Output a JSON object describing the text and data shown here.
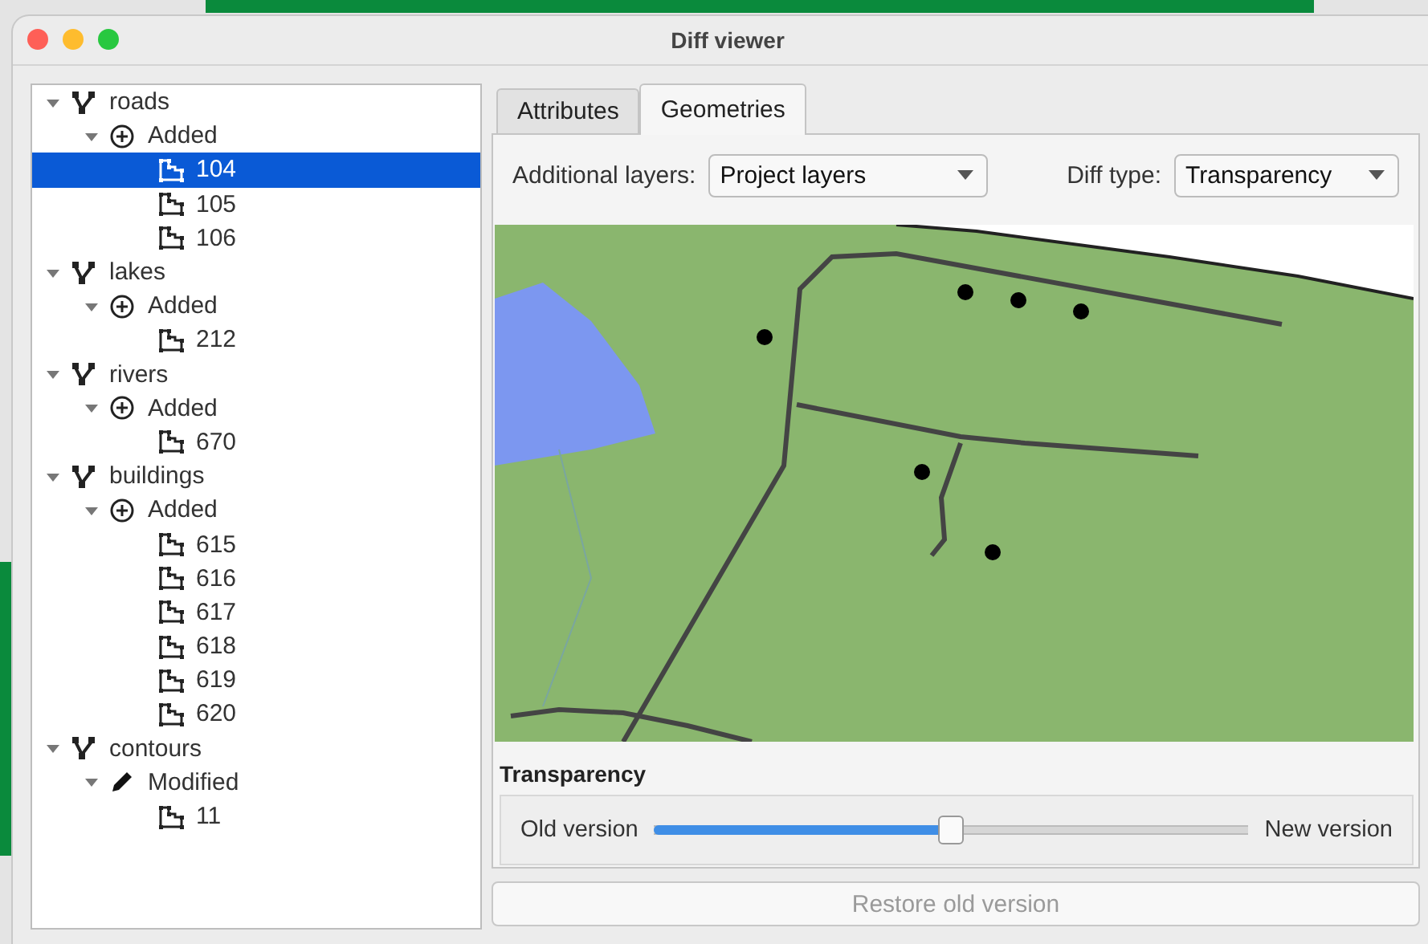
{
  "window": {
    "title": "Diff viewer"
  },
  "tree": [
    {
      "label": "roads",
      "kind": "layer",
      "expanded": true,
      "children": [
        {
          "label": "Added",
          "kind": "added",
          "expanded": true,
          "children": [
            {
              "label": "104",
              "kind": "feature",
              "selected": true
            },
            {
              "label": "105",
              "kind": "feature",
              "selected": false
            },
            {
              "label": "106",
              "kind": "feature",
              "selected": false
            }
          ]
        }
      ]
    },
    {
      "label": "lakes",
      "kind": "layer",
      "expanded": true,
      "children": [
        {
          "label": "Added",
          "kind": "added",
          "expanded": true,
          "children": [
            {
              "label": "212",
              "kind": "feature",
              "selected": false
            }
          ]
        }
      ]
    },
    {
      "label": "rivers",
      "kind": "layer",
      "expanded": true,
      "children": [
        {
          "label": "Added",
          "kind": "added",
          "expanded": true,
          "children": [
            {
              "label": "670",
              "kind": "feature",
              "selected": false
            }
          ]
        }
      ]
    },
    {
      "label": "buildings",
      "kind": "layer",
      "expanded": true,
      "children": [
        {
          "label": "Added",
          "kind": "added",
          "expanded": true,
          "children": [
            {
              "label": "615",
              "kind": "feature",
              "selected": false
            },
            {
              "label": "616",
              "kind": "feature",
              "selected": false
            },
            {
              "label": "617",
              "kind": "feature",
              "selected": false
            },
            {
              "label": "618",
              "kind": "feature",
              "selected": false
            },
            {
              "label": "619",
              "kind": "feature",
              "selected": false
            },
            {
              "label": "620",
              "kind": "feature",
              "selected": false
            }
          ]
        }
      ]
    },
    {
      "label": "contours",
      "kind": "layer",
      "expanded": true,
      "children": [
        {
          "label": "Modified",
          "kind": "modified",
          "expanded": true,
          "children": [
            {
              "label": "11",
              "kind": "feature",
              "selected": false
            }
          ]
        }
      ]
    }
  ],
  "tabs": [
    {
      "label": "Attributes",
      "selected": false
    },
    {
      "label": "Geometries",
      "selected": true
    }
  ],
  "additional_layers": {
    "label": "Additional layers:",
    "value": "Project layers"
  },
  "diff_type": {
    "label": "Diff type:",
    "value": "Transparency"
  },
  "transparency": {
    "title": "Transparency",
    "min_label": "Old version",
    "max_label": "New version",
    "level": 0.5
  },
  "restore_button": {
    "label": "Restore old version",
    "disabled": true
  }
}
